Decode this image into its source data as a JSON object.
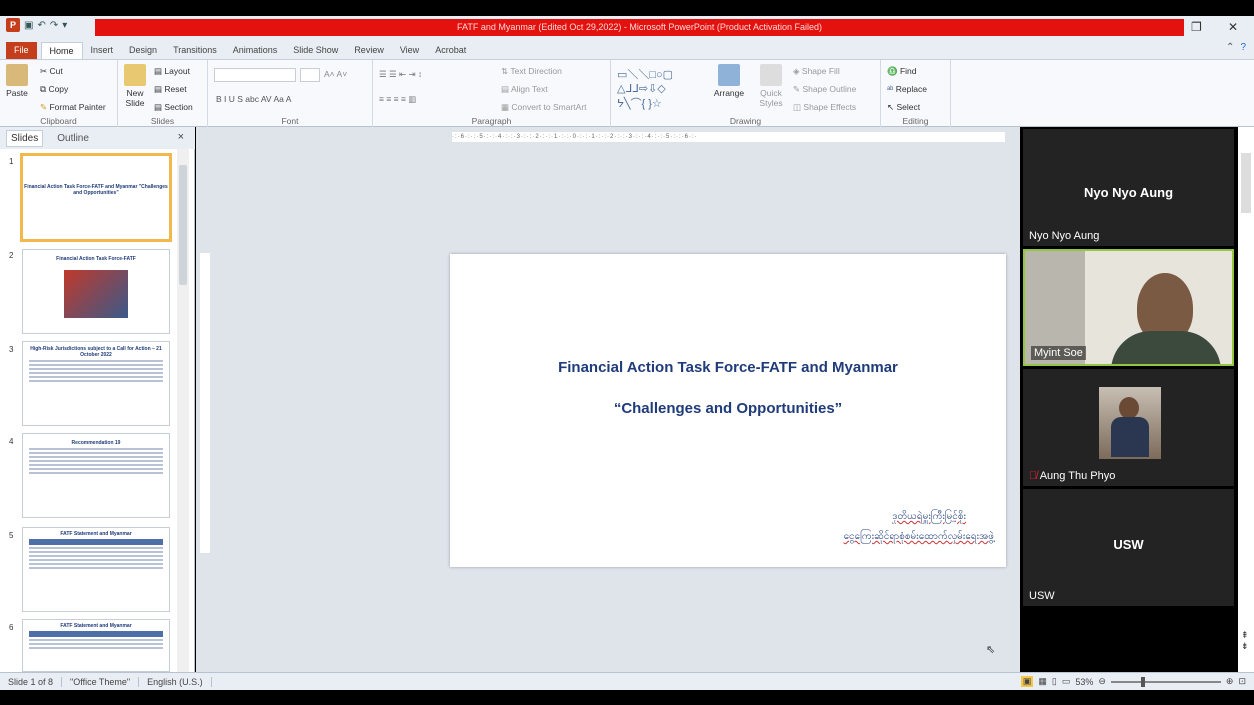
{
  "window": {
    "title": "FATF and Myanmar (Edited Oct 29,2022) - Microsoft PowerPoint (Product Activation Failed)"
  },
  "ribbon_tabs": [
    "File",
    "Home",
    "Insert",
    "Design",
    "Transitions",
    "Animations",
    "Slide Show",
    "Review",
    "View",
    "Acrobat"
  ],
  "ribbon": {
    "clipboard": {
      "paste": "Paste",
      "cut": "Cut",
      "copy": "Copy",
      "format_painter": "Format Painter",
      "label": "Clipboard"
    },
    "slides": {
      "new_slide": "New Slide",
      "layout": "Layout",
      "reset": "Reset",
      "section": "Section",
      "label": "Slides"
    },
    "font": {
      "label": "Font"
    },
    "paragraph": {
      "text_direction": "Text Direction",
      "align_text": "Align Text",
      "convert": "Convert to SmartArt",
      "label": "Paragraph"
    },
    "drawing": {
      "arrange": "Arrange",
      "quick_styles": "Quick Styles",
      "shape_fill": "Shape Fill",
      "shape_outline": "Shape Outline",
      "shape_effects": "Shape Effects",
      "label": "Drawing"
    },
    "editing": {
      "find": "Find",
      "replace": "Replace",
      "select": "Select",
      "label": "Editing"
    }
  },
  "pane": {
    "tab_slides": "Slides",
    "tab_outline": "Outline",
    "close": "×"
  },
  "thumbnails": [
    {
      "num": "1",
      "title": "Financial Action Task Force-FATF and Myanmar \"Challenges and Opportunities\""
    },
    {
      "num": "2",
      "title": "Financial Action Task Force-FATF"
    },
    {
      "num": "3",
      "title": "High-Risk Jurisdictions subject to a Call for Action – 21 October 2022"
    },
    {
      "num": "4",
      "title": "Recommendation 19"
    },
    {
      "num": "5",
      "title": "FATF Statement and Myanmar"
    },
    {
      "num": "6",
      "title": "FATF Statement and Myanmar"
    }
  ],
  "slide": {
    "title_line1": "Financial Action Task Force-FATF and Myanmar",
    "title_line2": "“Challenges and Opportunities”",
    "burmese_line1": "ဒုတိယရဲမှူးကြီးမြင့်စိုး",
    "burmese_line2": "ငွေကြေးဆိုင်ရာစုံစမ်းထောက်လှမ်းရေးအဖွဲ့"
  },
  "participants": [
    {
      "name_big": "Nyo Nyo Aung",
      "label": "Nyo Nyo Aung",
      "video": false
    },
    {
      "label": "Myint Soe",
      "video": true
    },
    {
      "label": "Aung Thu Phyo",
      "video": false,
      "muted": true
    },
    {
      "name_big": "USW",
      "label": "USW",
      "video": false
    }
  ],
  "status": {
    "slide_info": "Slide 1 of 8",
    "theme": "\"Office Theme\"",
    "language": "English (U.S.)",
    "zoom": "53%"
  },
  "colors": {
    "title_bar_red": "#e4120e",
    "file_tab": "#c43e1c",
    "slide_title": "#1f3b7a"
  }
}
